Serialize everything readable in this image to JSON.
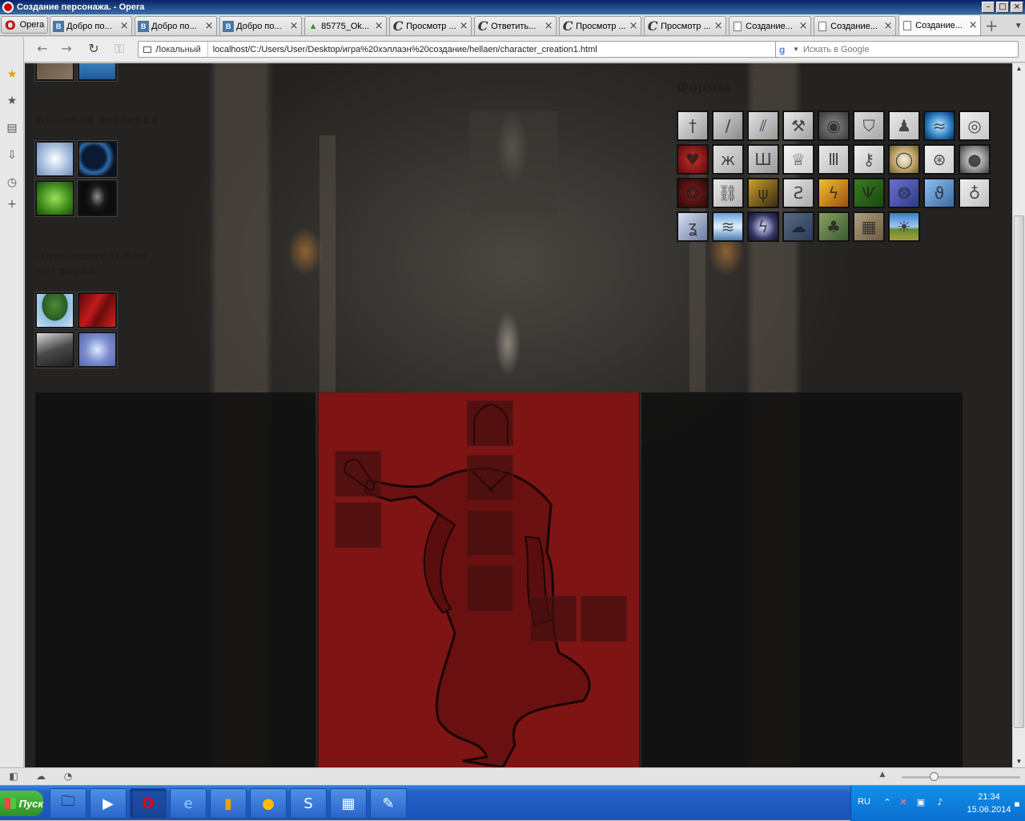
{
  "window": {
    "title": "Создание персонажа. - Opera"
  },
  "tabs": {
    "menu_label": "Opera",
    "items": [
      {
        "label": "Добро по...",
        "icon": "vk-icon"
      },
      {
        "label": "Добро по...",
        "icon": "vk-icon"
      },
      {
        "label": "Добро по...",
        "icon": "vk-icon"
      },
      {
        "label": "85775_Ok...",
        "icon": "image-icon"
      },
      {
        "label": "Просмотр ...",
        "icon": "c-icon"
      },
      {
        "label": "Ответить...",
        "icon": "c-icon"
      },
      {
        "label": "Просмотр ...",
        "icon": "c-icon"
      },
      {
        "label": "Просмотр ...",
        "icon": "c-icon"
      },
      {
        "label": "Создание...",
        "icon": "page-icon"
      },
      {
        "label": "Создание...",
        "icon": "page-icon"
      },
      {
        "label": "Создание...",
        "icon": "page-icon"
      }
    ],
    "vk_glyph": "В",
    "c_glyph": "С",
    "active_index": 10
  },
  "navbar": {
    "local_label": "Локальный",
    "url": "localhost/C:/Users/User/Desktop/игра%20хэллаэн%20создание/hellaen/character_creation1.html",
    "search_placeholder": "Искать в Google"
  },
  "page": {
    "high_quartet": {
      "title": "Высокая четверка",
      "icons": [
        "light-icon",
        "dark-sphere-icon",
        "leaf-icon",
        "reaper-icon"
      ]
    },
    "extra_quartet": {
      "title": "Дополнительная четверка",
      "icons": [
        "tree-icon",
        "red-cloth-icon",
        "machine-icon",
        "snowflake-icon"
      ]
    },
    "forms": {
      "title": "Формы",
      "icons": [
        {
          "name": "sword-icon",
          "glyph": "†"
        },
        {
          "name": "spear-icon",
          "glyph": "/"
        },
        {
          "name": "arrows-icon",
          "glyph": "⫽"
        },
        {
          "name": "hammer-icon",
          "glyph": "⚒"
        },
        {
          "name": "shield-icon",
          "glyph": "◉"
        },
        {
          "name": "armor-icon",
          "glyph": "⛉"
        },
        {
          "name": "body-icon",
          "glyph": "♟"
        },
        {
          "name": "energy-icon",
          "glyph": "≈"
        },
        {
          "name": "eye-icon",
          "glyph": "◎"
        },
        {
          "name": "heart-icon",
          "glyph": "♥"
        },
        {
          "name": "wings-icon",
          "glyph": "ж"
        },
        {
          "name": "claws-icon",
          "glyph": "Ш"
        },
        {
          "name": "crown-icon",
          "glyph": "♕"
        },
        {
          "name": "gate-icon",
          "glyph": "Ⅲ"
        },
        {
          "name": "key-icon",
          "glyph": "⚷"
        },
        {
          "name": "mirror-icon",
          "glyph": "◯"
        },
        {
          "name": "circle-runes-icon",
          "glyph": "⊛"
        },
        {
          "name": "crystal-ball-icon",
          "glyph": "●"
        },
        {
          "name": "seal-icon",
          "glyph": "❂"
        },
        {
          "name": "chain-icon",
          "glyph": "⛓"
        },
        {
          "name": "rune-gold-icon",
          "glyph": "ψ"
        },
        {
          "name": "rune-dark-icon",
          "glyph": "Ƨ"
        },
        {
          "name": "rune-orange-icon",
          "glyph": "ϟ"
        },
        {
          "name": "rune-green-icon",
          "glyph": "Ѱ"
        },
        {
          "name": "rune-purple-icon",
          "glyph": "⨷"
        },
        {
          "name": "rune-blue-icon",
          "glyph": "ϑ"
        },
        {
          "name": "orb-cross-icon",
          "glyph": "♁"
        },
        {
          "name": "spiral-icon",
          "glyph": "ʓ"
        },
        {
          "name": "waterfall-icon",
          "glyph": "≋"
        },
        {
          "name": "lightning-icon",
          "glyph": "ϟ"
        },
        {
          "name": "storm-icon",
          "glyph": "☁"
        },
        {
          "name": "forest-icon",
          "glyph": "♣"
        },
        {
          "name": "wall-icon",
          "glyph": "▦"
        },
        {
          "name": "field-icon",
          "glyph": "☀"
        }
      ]
    }
  },
  "taskbar": {
    "start_label": "Пуск",
    "lang": "RU",
    "time": "21:34",
    "date": "15.06.2014"
  },
  "colors": {
    "page_bg": "#3a3936",
    "center_panel": "#7e1414",
    "side_panels": "#101010"
  }
}
